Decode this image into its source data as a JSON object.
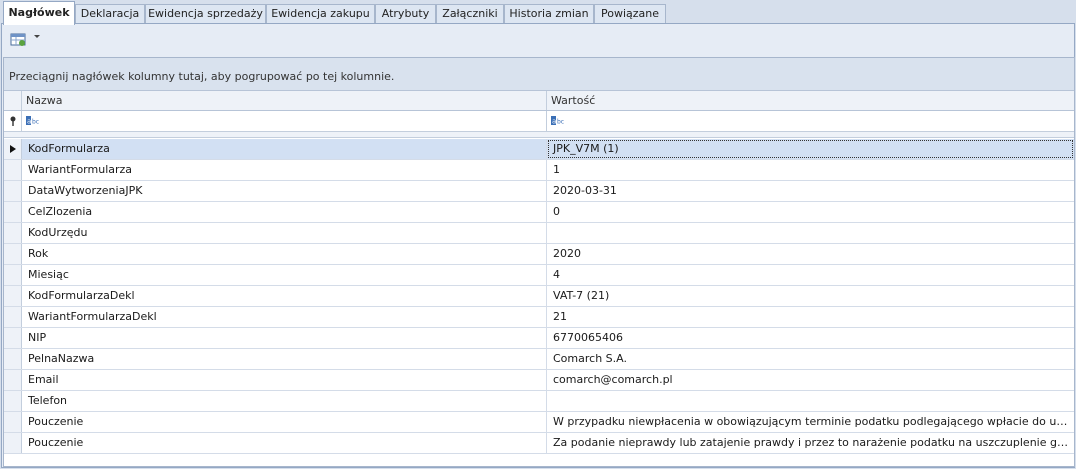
{
  "tabs": [
    {
      "label": "Nagłówek",
      "active": true
    },
    {
      "label": "Deklaracja"
    },
    {
      "label": "Ewidencja sprzedaży"
    },
    {
      "label": "Ewidencja zakupu"
    },
    {
      "label": "Atrybuty"
    },
    {
      "label": "Załączniki"
    },
    {
      "label": "Historia zmian"
    },
    {
      "label": "Powiązane"
    }
  ],
  "toolbar": {
    "layout_icon": "grid-layout-icon",
    "dropdown_icon": "chevron-down-icon"
  },
  "grid": {
    "group_hint": "Przeciągnij nagłówek kolumny tutaj, aby pogrupować po tej kolumnie.",
    "columns": [
      "Nazwa",
      "Wartość"
    ],
    "filter_icon": "filter-pin-icon",
    "filter_cell_icon": "abc-text-filter-icon",
    "rows": [
      {
        "name": "KodFormularza",
        "value": "JPK_V7M (1)"
      },
      {
        "name": "WariantFormularza",
        "value": "1"
      },
      {
        "name": "DataWytworzeniaJPK",
        "value": "2020-03-31"
      },
      {
        "name": "CelZlozenia",
        "value": "0"
      },
      {
        "name": "KodUrzędu",
        "value": ""
      },
      {
        "name": "Rok",
        "value": "2020"
      },
      {
        "name": "Miesiąc",
        "value": "4"
      },
      {
        "name": "KodFormularzaDekl",
        "value": "VAT-7 (21)"
      },
      {
        "name": "WariantFormularzaDekl",
        "value": "21"
      },
      {
        "name": "NIP",
        "value": "6770065406"
      },
      {
        "name": "PelnaNazwa",
        "value": "Comarch S.A."
      },
      {
        "name": "Email",
        "value": "comarch@comarch.pl"
      },
      {
        "name": "Telefon",
        "value": ""
      },
      {
        "name": "Pouczenie",
        "value": "W przypadku niewpłacenia w obowiązującym terminie podatku podlegającego wpłacie do urzędu s..."
      },
      {
        "name": "Pouczenie",
        "value": "Za podanie nieprawdy lub zatajenie prawdy i przez to narażenie podatku na uszczuplenie grozi od..."
      }
    ]
  },
  "colors": {
    "accent": "#d2e0f3",
    "border": "#95a8c4",
    "panel": "#e6ecf5"
  }
}
